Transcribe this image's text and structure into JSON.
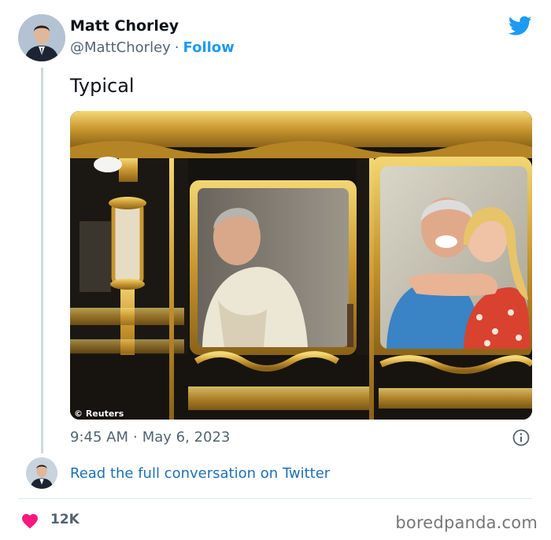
{
  "tweet": {
    "author": {
      "display_name": "Matt Chorley",
      "handle": "@MattChorley",
      "avatar_icon": "profile-photo"
    },
    "follow_label": "Follow",
    "text": "Typical",
    "image": {
      "credit": "© Reuters"
    },
    "time": "9:45 AM",
    "date": "May 6, 2023",
    "read_more_label": "Read the full conversation on Twitter",
    "likes": "12K"
  },
  "icons": {
    "brand": "twitter-bird-icon",
    "info": "info-icon",
    "like": "heart-icon"
  },
  "watermark": "boredpanda.com",
  "colors": {
    "twitter_blue": "#1d9bf0",
    "link_blue": "#1d70b8",
    "heart_pink": "#f91880",
    "muted": "#536471"
  }
}
